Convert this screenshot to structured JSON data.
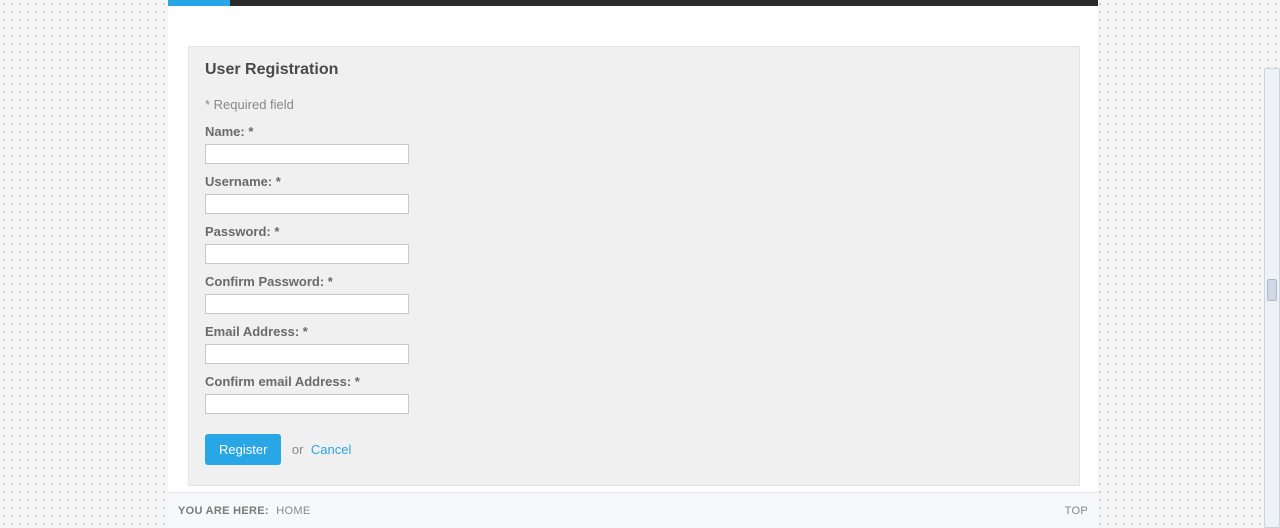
{
  "form": {
    "title": "User Registration",
    "required_note": "* Required field",
    "fields": {
      "name": {
        "label": "Name: *",
        "value": ""
      },
      "username": {
        "label": "Username: *",
        "value": ""
      },
      "password": {
        "label": "Password: *",
        "value": ""
      },
      "confirm_password": {
        "label": "Confirm Password: *",
        "value": ""
      },
      "email": {
        "label": "Email Address: *",
        "value": ""
      },
      "confirm_email": {
        "label": "Confirm email Address: *",
        "value": ""
      }
    },
    "actions": {
      "register_label": "Register",
      "or_text": "or",
      "cancel_label": "Cancel"
    }
  },
  "footer": {
    "breadcrumb_label": "YOU ARE HERE:",
    "breadcrumb_current": "HOME",
    "top_label": "TOP"
  },
  "colors": {
    "accent": "#29a6e5",
    "panel_bg": "#f0f0f0",
    "text_muted": "#888888"
  }
}
